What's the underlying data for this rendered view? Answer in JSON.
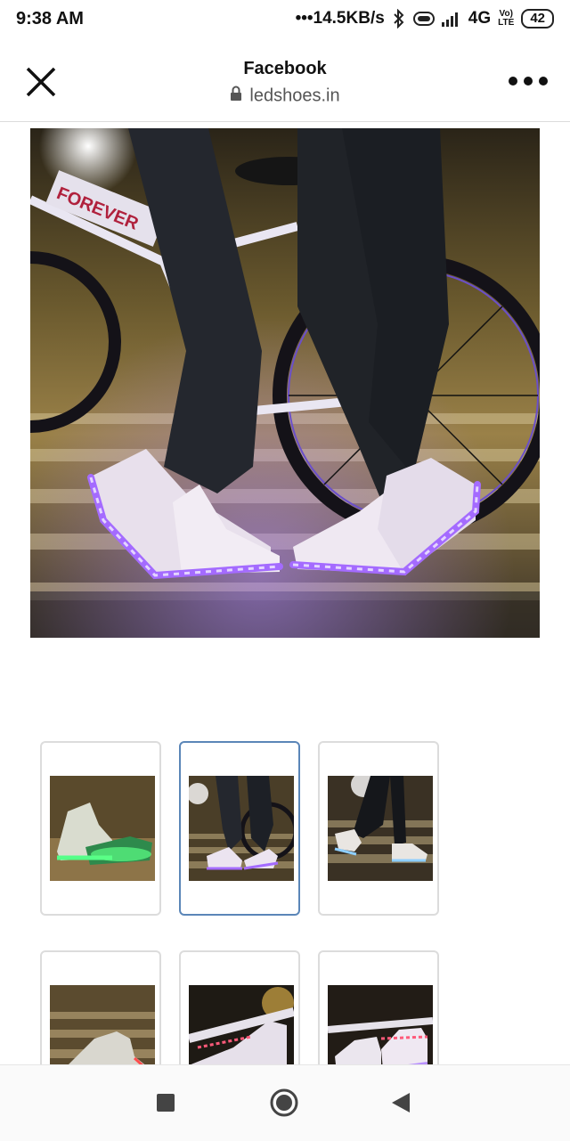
{
  "status_bar": {
    "time": "9:38 AM",
    "speed": "•••14.5KB/s",
    "network": "4G",
    "volte_top": "Vo)",
    "volte_bottom": "LTE",
    "battery": "42"
  },
  "header": {
    "title": "Facebook",
    "url": "ledshoes.in"
  },
  "main_image": {
    "description_icon": "product-photo",
    "bike_text": "FOREVER"
  },
  "thumbnails": [
    {
      "selected": false
    },
    {
      "selected": true
    },
    {
      "selected": false
    },
    {
      "selected": false
    },
    {
      "selected": false
    },
    {
      "selected": false
    }
  ],
  "colors": {
    "accent_selected": "#5b86b8",
    "led_purple": "#8a5cff",
    "led_green": "#4dff7a"
  },
  "nav": {
    "icons": [
      "recent-apps-icon",
      "home-icon",
      "back-icon"
    ]
  }
}
